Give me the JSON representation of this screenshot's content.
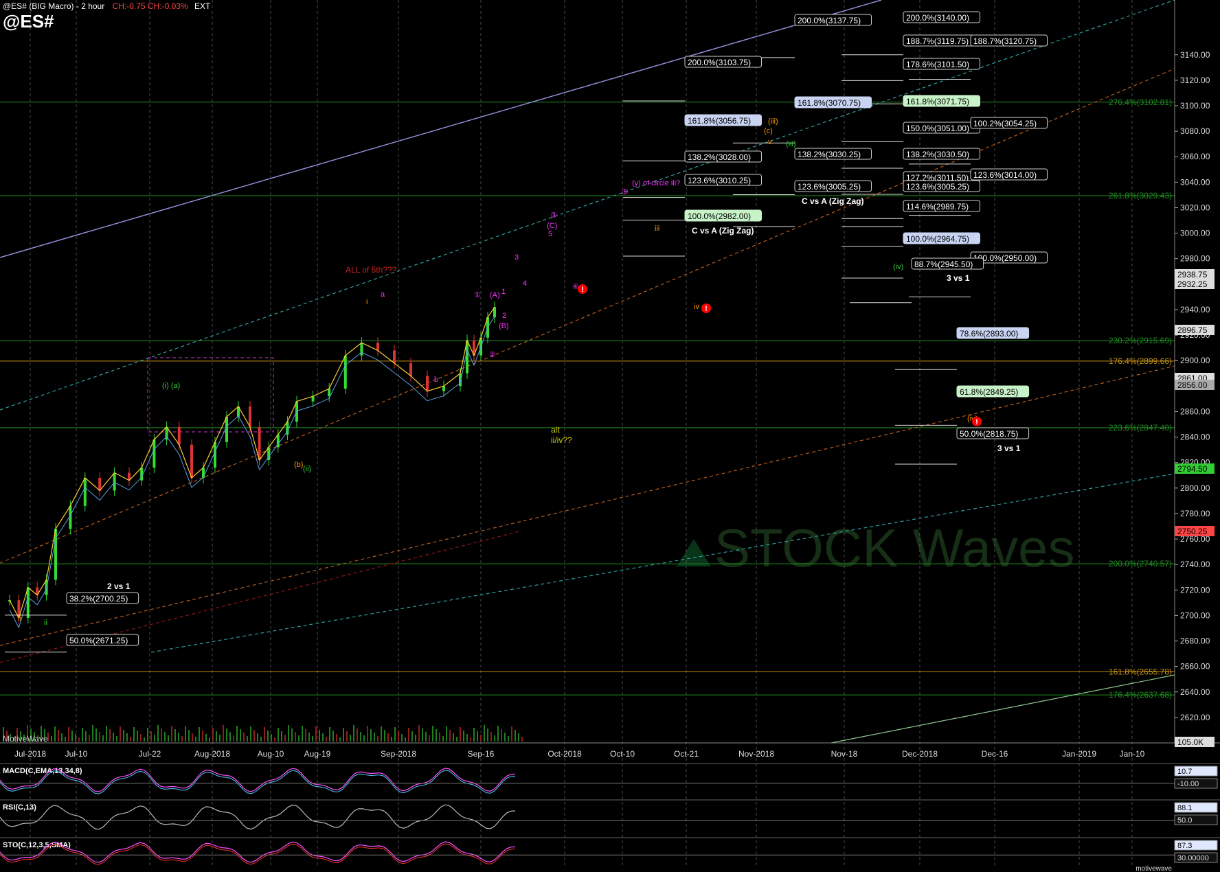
{
  "header": {
    "title": "@ES# (BIG Macro) - 2 hour",
    "change": "CH:-0.75 CH:-0.03%",
    "session": "EXT",
    "symbol": "@ES#"
  },
  "colors": {
    "background": "#000000",
    "grid": "#2a2a2a",
    "green_line": "#1f8f1f",
    "orange_line": "#c89414",
    "purple": "#ff33ff",
    "orange_label": "#ff9900",
    "green_label": "#33cc33",
    "red_alert": "#ff0000"
  },
  "chart_data": {
    "type": "line",
    "title": "@ES# (BIG Macro) - 2 hour",
    "ylim": [
      2600,
      3150
    ],
    "y_ticks": [
      "3140.00",
      "3120.00",
      "3100.00",
      "3080.00",
      "3060.00",
      "3040.00",
      "3020.00",
      "3000.00",
      "2980.00",
      "2960.00",
      "2940.00",
      "2920.00",
      "2900.00",
      "2880.00",
      "2860.00",
      "2840.00",
      "2820.00",
      "2800.00",
      "2780.00",
      "2760.00",
      "2740.00",
      "2720.00",
      "2700.00",
      "2680.00",
      "2660.00",
      "2640.00",
      "2620.00"
    ],
    "x_ticks": [
      "Jul-2018",
      "Jul-10",
      "Jul-22",
      "Aug-2018",
      "Aug-10",
      "Aug-19",
      "Sep-2018",
      "Sep-16",
      "Oct-2018",
      "Oct-10",
      "Oct-21",
      "Nov-2018",
      "Nov-18",
      "Dec-2018",
      "Dec-16",
      "Jan-2019",
      "Jan-10"
    ],
    "price": [
      [
        "Jul-2018",
        2712
      ],
      [
        "Jul-2018",
        2698
      ],
      [
        "Jul-2018",
        2722
      ],
      [
        "Jul-2018",
        2716
      ],
      [
        "Jul-2018",
        2728
      ],
      [
        "Jul-10",
        2768
      ],
      [
        "Jul-10",
        2786
      ],
      [
        "Jul-10",
        2808
      ],
      [
        "Jul-10",
        2798
      ],
      [
        "Jul-10",
        2812
      ],
      [
        "Jul-22",
        2806
      ],
      [
        "Jul-22",
        2816
      ],
      [
        "Jul-22",
        2838
      ],
      [
        "Jul-22",
        2848
      ],
      [
        "Jul-22",
        2834
      ],
      [
        "Aug-2018",
        2808
      ],
      [
        "Aug-2018",
        2816
      ],
      [
        "Aug-2018",
        2836
      ],
      [
        "Aug-2018",
        2856
      ],
      [
        "Aug-2018",
        2864
      ],
      [
        "Aug-10",
        2848
      ],
      [
        "Aug-10",
        2822
      ],
      [
        "Aug-10",
        2832
      ],
      [
        "Aug-10",
        2842
      ],
      [
        "Aug-10",
        2852
      ],
      [
        "Aug-19",
        2868
      ],
      [
        "Aug-19",
        2872
      ],
      [
        "Aug-19",
        2878
      ],
      [
        "Aug-19",
        2904
      ],
      [
        "Aug-19",
        2914
      ],
      [
        "Sep-2018",
        2908
      ],
      [
        "Sep-2018",
        2898
      ],
      [
        "Sep-2018",
        2888
      ],
      [
        "Sep-2018",
        2876
      ],
      [
        "Sep-2018",
        2880
      ],
      [
        "Sep-16",
        2890
      ],
      [
        "Sep-16",
        2916
      ],
      [
        "Sep-16",
        2904
      ],
      [
        "Sep-16",
        2918
      ],
      [
        "Sep-16",
        2934
      ],
      [
        "Sep-16",
        2942
      ]
    ],
    "price_tags": [
      {
        "label": "2938.75",
        "color": "#dddddd"
      },
      {
        "label": "2932.25",
        "color": "#dddddd"
      },
      {
        "label": "2896.75",
        "color": "#dddddd"
      },
      {
        "label": "2861.00",
        "color": "#dddddd"
      },
      {
        "label": "2856.00",
        "color": "#aaaaaa"
      },
      {
        "label": "2794.50",
        "color": "#33cc33"
      },
      {
        "label": "2750.25",
        "color": "#ff4444"
      },
      {
        "label": "105.0K",
        "color": "#dddddd"
      }
    ],
    "fib_boxes": [
      {
        "label": "200.0%(3140.00)",
        "style": "dark"
      },
      {
        "label": "200.0%(3137.75)",
        "style": "dark"
      },
      {
        "label": "188.7%(3119.75)",
        "style": "dark"
      },
      {
        "label": "188.7%(3120.75)",
        "style": "dark"
      },
      {
        "label": "200.0%(3103.75)",
        "style": "dark"
      },
      {
        "label": "178.6%(3101.50)",
        "style": "dark"
      },
      {
        "label": "161.8%(3070.75)",
        "style": "blue"
      },
      {
        "label": "161.8%(3071.75)",
        "style": "green"
      },
      {
        "label": "161.8%(3056.75)",
        "style": "blue"
      },
      {
        "label": "150.0%(3051.00)",
        "style": "dark"
      },
      {
        "label": "100.2%(3054.25)",
        "style": "dark"
      },
      {
        "label": "138.2%(3028.00)",
        "style": "dark"
      },
      {
        "label": "138.2%(3030.25)",
        "style": "dark"
      },
      {
        "label": "138.2%(3030.50)",
        "style": "dark"
      },
      {
        "label": "123.6%(3010.25)",
        "style": "dark"
      },
      {
        "label": "127.2%(3011.50)",
        "style": "dark"
      },
      {
        "label": "123.6%(3014.00)",
        "style": "dark"
      },
      {
        "label": "123.6%(3005.25)",
        "style": "dark"
      },
      {
        "label": "123.6%(3005.25)",
        "style": "dark"
      },
      {
        "label": "114.6%(2989.75)",
        "style": "dark"
      },
      {
        "label": "100.0%(2982.00)",
        "style": "green"
      },
      {
        "label": "100.0%(2964.75)",
        "style": "blue"
      },
      {
        "label": "100.0%(2950.00)",
        "style": "dark"
      },
      {
        "label": "88.7%(2945.50)",
        "style": "dark"
      },
      {
        "label": "78.6%(2893.00)",
        "style": "blue"
      },
      {
        "label": "61.8%(2849.25)",
        "style": "green"
      },
      {
        "label": "50.0%(2818.75)",
        "style": "dark"
      },
      {
        "label": "38.2%(2700.25)",
        "style": "dark"
      },
      {
        "label": "50.0%(2671.25)",
        "style": "dark"
      }
    ],
    "fib_green_levels": [
      {
        "label": "276.4%(3102.81)"
      },
      {
        "label": "261.8%(3029.43)"
      },
      {
        "label": "230.2%(2915.69)"
      },
      {
        "label": "223.6%(2847.40)"
      },
      {
        "label": "200.0%(2740.57)"
      },
      {
        "label": "176.4%(2637.68)"
      }
    ],
    "fib_orange_levels": [
      {
        "label": "176.4%(2899.66)"
      },
      {
        "label": "161.8%(2655.78)"
      }
    ],
    "text_labels": [
      {
        "text": "C vs A (Zig Zag)",
        "color": "#ffffff"
      },
      {
        "text": "C vs A (Zig Zag)",
        "color": "#ffffff"
      },
      {
        "text": "3 vs 1",
        "color": "#ffffff"
      },
      {
        "text": "3 vs 1",
        "color": "#ffffff"
      },
      {
        "text": "2 vs 1",
        "color": "#ffffff"
      },
      {
        "text": "ALL of 5th???",
        "color": "#cc2222"
      },
      {
        "text": "alt",
        "color": "#cccc00"
      },
      {
        "text": "ii/iv??",
        "color": "#cccc00"
      },
      {
        "text": "MotiveWave",
        "color": "#cccccc"
      }
    ],
    "wave_labels": [
      {
        "text": "(i) (a)",
        "color": "#33cc33"
      },
      {
        "text": "(b)",
        "color": "#ff9900"
      },
      {
        "text": "(ii)",
        "color": "#33cc33"
      },
      {
        "text": "ii",
        "color": "#ff9900"
      },
      {
        "text": "ii",
        "color": "#33cc33"
      },
      {
        "text": "i",
        "color": "#ff9900"
      },
      {
        "text": "a",
        "color": "#ff33ff"
      },
      {
        "text": "b",
        "color": "#ff33ff"
      },
      {
        "text": "①",
        "color": "#ff33ff"
      },
      {
        "text": "(A)",
        "color": "#ff33ff"
      },
      {
        "text": "1",
        "color": "#ff33ff"
      },
      {
        "text": "2",
        "color": "#ff33ff"
      },
      {
        "text": "②",
        "color": "#ff33ff"
      },
      {
        "text": "(B)",
        "color": "#ff33ff"
      },
      {
        "text": "3",
        "color": "#ff33ff"
      },
      {
        "text": "4",
        "color": "#ff33ff"
      },
      {
        "text": "③",
        "color": "#ff33ff"
      },
      {
        "text": "(C)",
        "color": "#ff33ff"
      },
      {
        "text": "5",
        "color": "#ff33ff"
      },
      {
        "text": "④",
        "color": "#ff33ff"
      },
      {
        "text": "⑤",
        "color": "#ff33ff"
      },
      {
        "text": "(y) of circle iii?",
        "color": "#ff33ff"
      },
      {
        "text": "iii",
        "color": "#ff9900"
      },
      {
        "text": "iv",
        "color": "#ff9900"
      },
      {
        "text": "(iii)",
        "color": "#ff9900"
      },
      {
        "text": "(c)",
        "color": "#ff9900"
      },
      {
        "text": "v",
        "color": "#ff9900"
      },
      {
        "text": "(iii)",
        "color": "#33cc33"
      },
      {
        "text": "(iv)",
        "color": "#33cc33"
      },
      {
        "text": "(iv)",
        "color": "#ff9900"
      }
    ],
    "panels": {
      "macd": {
        "label": "MACD(C,EMA,13,34,8)",
        "tags": [
          "10.7",
          "-10.00"
        ]
      },
      "rsi": {
        "label": "RSI(C,13)",
        "tags": [
          "88.1",
          "50.0"
        ]
      },
      "stoch": {
        "label": "STO(C,12,3,5,SMA)",
        "tags": [
          "87.3",
          "30.00000"
        ]
      }
    },
    "watermark": "STOCK Waves",
    "brand": "motivewave"
  }
}
